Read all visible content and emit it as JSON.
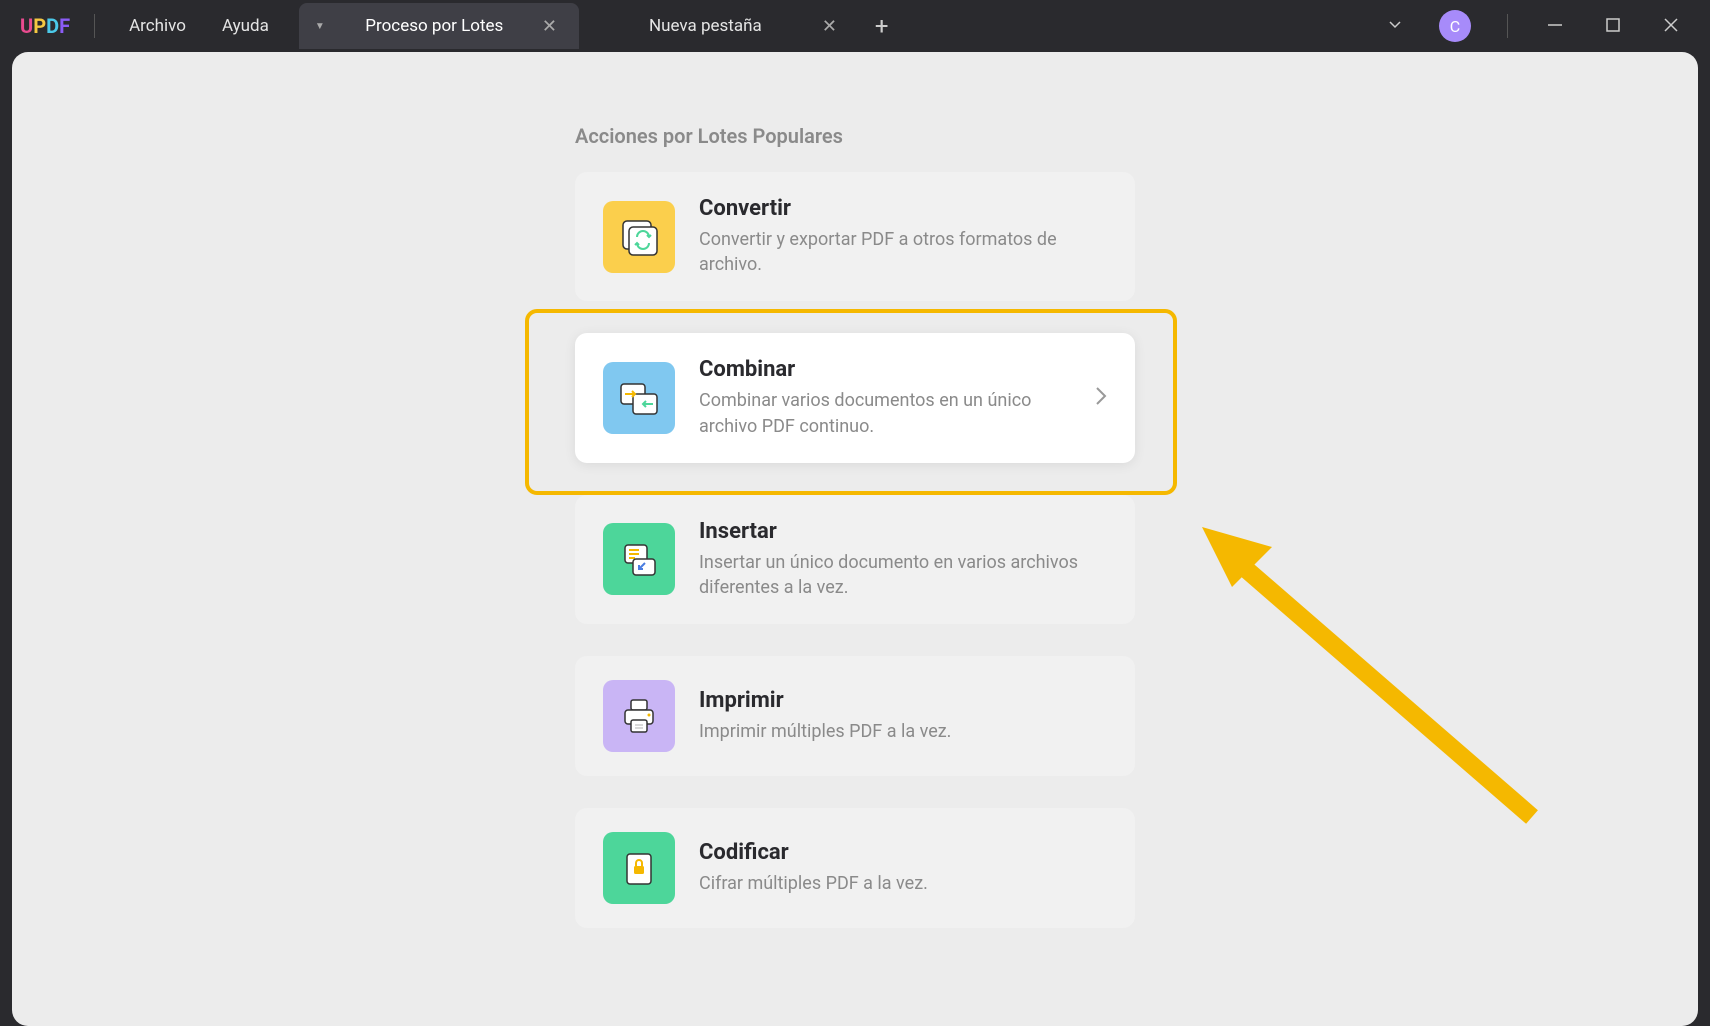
{
  "app": {
    "logo_letters": [
      "U",
      "P",
      "D",
      "F"
    ],
    "menu": {
      "file": "Archivo",
      "help": "Ayuda"
    },
    "tabs": [
      {
        "label": "Proceso por Lotes",
        "active": true
      },
      {
        "label": "Nueva pestaña",
        "active": false
      }
    ],
    "avatar_initial": "C"
  },
  "section_title": "Acciones por Lotes Populares",
  "actions": [
    {
      "title": "Convertir",
      "desc": "Convertir y exportar PDF a otros formatos de archivo.",
      "color": "yellow",
      "icon": "convert"
    },
    {
      "title": "Combinar",
      "desc": "Combinar varios documentos en un único archivo PDF continuo.",
      "color": "blue",
      "icon": "combine",
      "highlighted": true
    },
    {
      "title": "Insertar",
      "desc": "Insertar un único documento en varios archivos diferentes a la vez.",
      "color": "green",
      "icon": "insert"
    },
    {
      "title": "Imprimir",
      "desc": "Imprimir múltiples PDF a la vez.",
      "color": "purple",
      "icon": "print"
    },
    {
      "title": "Codificar",
      "desc": "Cifrar múltiples PDF a la vez.",
      "color": "green",
      "icon": "encrypt"
    }
  ]
}
